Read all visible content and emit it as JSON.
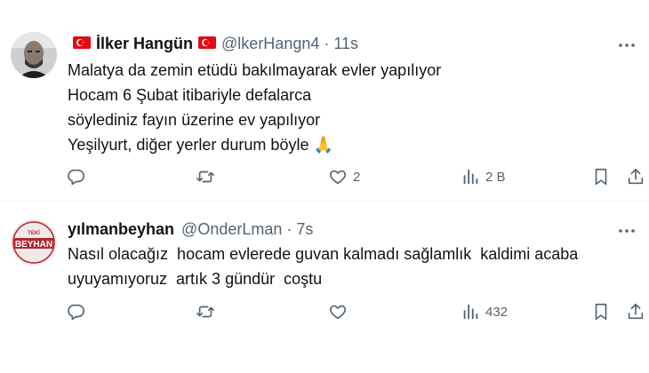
{
  "colors": {
    "text": "#0f1419",
    "secondary": "#536471",
    "divider": "#eff3f4",
    "flag_red": "#e30a17"
  },
  "tweets": [
    {
      "author": "İlker Hangün",
      "handle": "@lkerHangn4",
      "separator": "·",
      "time": "11s",
      "name_flags": [
        "turkey-flag",
        "turkey-flag"
      ],
      "lines": [
        "Malatya da zemin etüdü bakılmayarak evler yapılıyor",
        "Hocam 6 Şubat itibariyle defalarca",
        "söylediniz fayın üzerine ev yapılıyor",
        "Yeşilyurt, diğer yerler durum böyle 🙏"
      ],
      "reply_count": "",
      "retweet_count": "",
      "like_count": "2",
      "view_count": "2 B"
    },
    {
      "author": "yılmanbeyhan",
      "handle": "@OnderLman",
      "separator": "·",
      "time": "7s",
      "avatar_text": {
        "top": "TEKİ",
        "main": "BEYHAN"
      },
      "lines": [
        "Nasıl olacağız  hocam evlerede guvan kalmadı sağlamlık  kaldimi acaba",
        "uyuyamıyoruz  artık 3 gündür  coştu"
      ],
      "reply_count": "",
      "retweet_count": "",
      "like_count": "",
      "view_count": "432"
    }
  ],
  "icons": [
    "reply-icon",
    "retweet-icon",
    "like-icon",
    "views-icon",
    "bookmark-icon",
    "share-icon",
    "more-icon"
  ]
}
